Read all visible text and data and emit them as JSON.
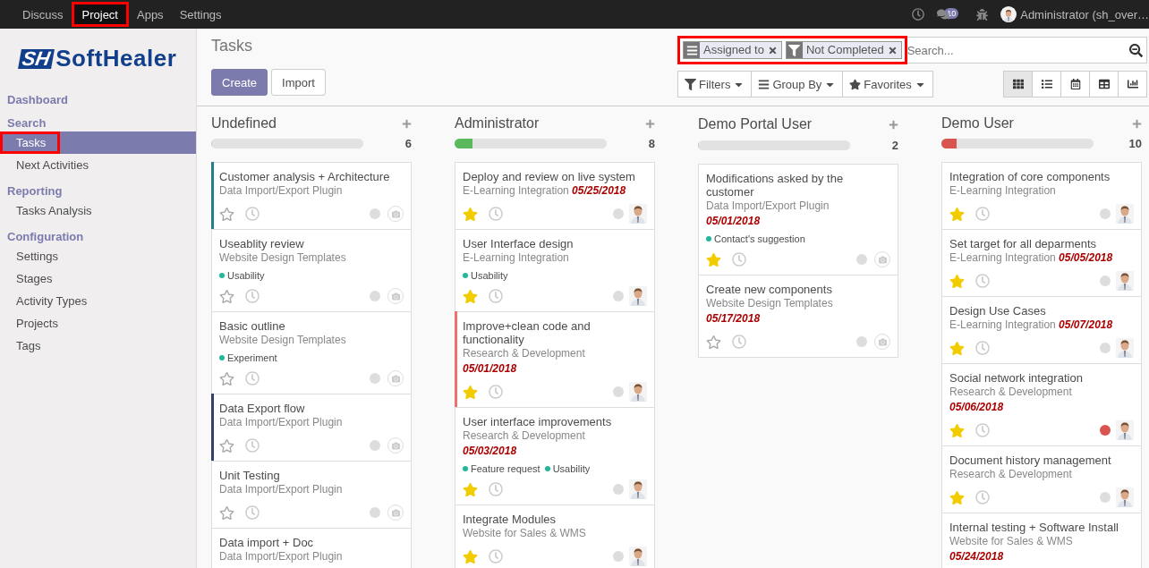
{
  "top_menu": [
    {
      "label": "Discuss",
      "selected": false,
      "highlighted": false
    },
    {
      "label": "Project",
      "selected": true,
      "highlighted": true
    },
    {
      "label": "Apps",
      "selected": false,
      "highlighted": false
    },
    {
      "label": "Settings",
      "selected": false,
      "highlighted": false
    }
  ],
  "systray": {
    "message_count": "10",
    "user": "Administrator (sh_over…"
  },
  "logo": {
    "mark": "SH",
    "name": "SoftHealer"
  },
  "sidebar": [
    {
      "title": "Dashboard"
    },
    {
      "title": "Search",
      "items": [
        {
          "label": "Tasks",
          "selected": true,
          "highlighted": true
        },
        {
          "label": "Next Activities",
          "selected": false,
          "highlighted": false
        }
      ]
    },
    {
      "title": "Reporting",
      "items": [
        {
          "label": "Tasks Analysis",
          "selected": false,
          "highlighted": false
        }
      ]
    },
    {
      "title": "Configuration",
      "items": [
        {
          "label": "Settings",
          "selected": false,
          "highlighted": false
        },
        {
          "label": "Stages",
          "selected": false,
          "highlighted": false
        },
        {
          "label": "Activity Types",
          "selected": false,
          "highlighted": false
        },
        {
          "label": "Projects",
          "selected": false,
          "highlighted": false
        },
        {
          "label": "Tags",
          "selected": false,
          "highlighted": false
        }
      ]
    }
  ],
  "page_title": "Tasks",
  "buttons": [
    {
      "label": "Create",
      "kind": "primary"
    },
    {
      "label": "Import",
      "kind": "secondary"
    }
  ],
  "search": {
    "placeholder": "Search...",
    "facets_highlighted": true,
    "facets": [
      {
        "kind": "groupby",
        "label": "Assigned to"
      },
      {
        "kind": "filter",
        "label": "Not Completed"
      }
    ]
  },
  "search_options": [
    {
      "kind": "filter",
      "label": "Filters"
    },
    {
      "kind": "groupby",
      "label": "Group By"
    },
    {
      "kind": "favorite",
      "label": "Favorites"
    }
  ],
  "views": [
    {
      "kind": "kanban",
      "selected": true
    },
    {
      "kind": "list",
      "selected": false
    },
    {
      "kind": "calendar",
      "selected": false
    },
    {
      "kind": "pivot",
      "selected": false
    },
    {
      "kind": "graph",
      "selected": false
    }
  ],
  "columns": [
    {
      "title": "Undefined",
      "count": "6",
      "level": 0,
      "cards": [
        {
          "title": "Customer analysis + Architecture",
          "project": "Data Import/Export Plugin",
          "color": "#1f7f8c",
          "starred": false,
          "blocked": false,
          "assigned": false
        },
        {
          "title": "Useablity review",
          "project": "Website Design Templates",
          "tags": [
            {
              "label": "Usability",
              "color": "#21b799"
            }
          ],
          "starred": false,
          "blocked": false,
          "assigned": false
        },
        {
          "title": "Basic outline",
          "project": "Website Design Templates",
          "tags": [
            {
              "label": "Experiment",
              "color": "#21b799"
            }
          ],
          "starred": false,
          "blocked": false,
          "assigned": false
        },
        {
          "title": "Data Export flow",
          "project": "Data Import/Export Plugin",
          "color": "#34406a",
          "starred": false,
          "blocked": false,
          "assigned": false
        },
        {
          "title": "Unit Testing",
          "project": "Data Import/Export Plugin",
          "starred": false,
          "blocked": false,
          "assigned": false
        },
        {
          "title": "Data import + Doc",
          "project": "Data Import/Export Plugin"
        }
      ]
    },
    {
      "title": "Administrator",
      "count": "8",
      "level": 0.12,
      "color": "#5cb85c",
      "cards": [
        {
          "title": "Deploy and review on live system",
          "project": "E-Learning Integration",
          "date": "05/25/2018",
          "starred": true,
          "blocked": false,
          "assigned": true
        },
        {
          "title": "User Interface design",
          "project": "E-Learning Integration",
          "tags": [
            {
              "label": "Usability",
              "color": "#21b799"
            }
          ],
          "starred": true,
          "blocked": false,
          "assigned": true
        },
        {
          "title": "Improve+clean code and functionality",
          "project": "Research & Development",
          "date": "05/01/2018",
          "date_newline": true,
          "color": "#f06f6f",
          "starred": true,
          "blocked": false,
          "assigned": true
        },
        {
          "title": "User interface improvements",
          "project": "Research & Development",
          "date": "05/03/2018",
          "date_newline": true,
          "tags": [
            {
              "label": "Feature request",
              "color": "#21b799"
            },
            {
              "label": "Usability",
              "color": "#21b799"
            }
          ],
          "starred": true,
          "blocked": false,
          "assigned": true
        },
        {
          "title": "Integrate Modules",
          "project": "Website for Sales & WMS",
          "starred": true,
          "blocked": false,
          "assigned": true
        }
      ]
    },
    {
      "title": "Demo Portal User",
      "count": "2",
      "level": 0,
      "cards": [
        {
          "title": "Modifications asked by the customer",
          "project": "Data Import/Export Plugin",
          "date": "05/01/2018",
          "date_newline": true,
          "tags": [
            {
              "label": "Contact's suggestion",
              "color": "#21b799"
            }
          ],
          "starred": true,
          "blocked": false,
          "assigned": false
        },
        {
          "title": "Create new components",
          "project": "Website Design Templates",
          "date": "05/17/2018",
          "date_newline": true,
          "starred": false,
          "blocked": false,
          "assigned": false
        }
      ]
    },
    {
      "title": "Demo User",
      "count": "10",
      "level": 0.1,
      "color": "#d9534f",
      "cards": [
        {
          "title": "Integration of core components",
          "project": "E-Learning Integration",
          "starred": true,
          "blocked": false,
          "assigned": true
        },
        {
          "title": "Set target for all deparments",
          "project": "E-Learning Integration",
          "date": "05/05/2018",
          "starred": true,
          "blocked": false,
          "assigned": true
        },
        {
          "title": "Design Use Cases",
          "project": "E-Learning Integration",
          "date": "05/07/2018",
          "starred": true,
          "blocked": false,
          "assigned": true
        },
        {
          "title": "Social network integration",
          "project": "Research & Development",
          "date": "05/06/2018",
          "date_newline": true,
          "starred": true,
          "blocked": true,
          "assigned": true
        },
        {
          "title": "Document history management",
          "project": "Research & Development",
          "starred": true,
          "blocked": false,
          "assigned": true
        },
        {
          "title": "Internal testing + Software Install",
          "project": "Website for Sales & WMS",
          "date": "05/24/2018",
          "date_newline": true
        }
      ]
    }
  ]
}
